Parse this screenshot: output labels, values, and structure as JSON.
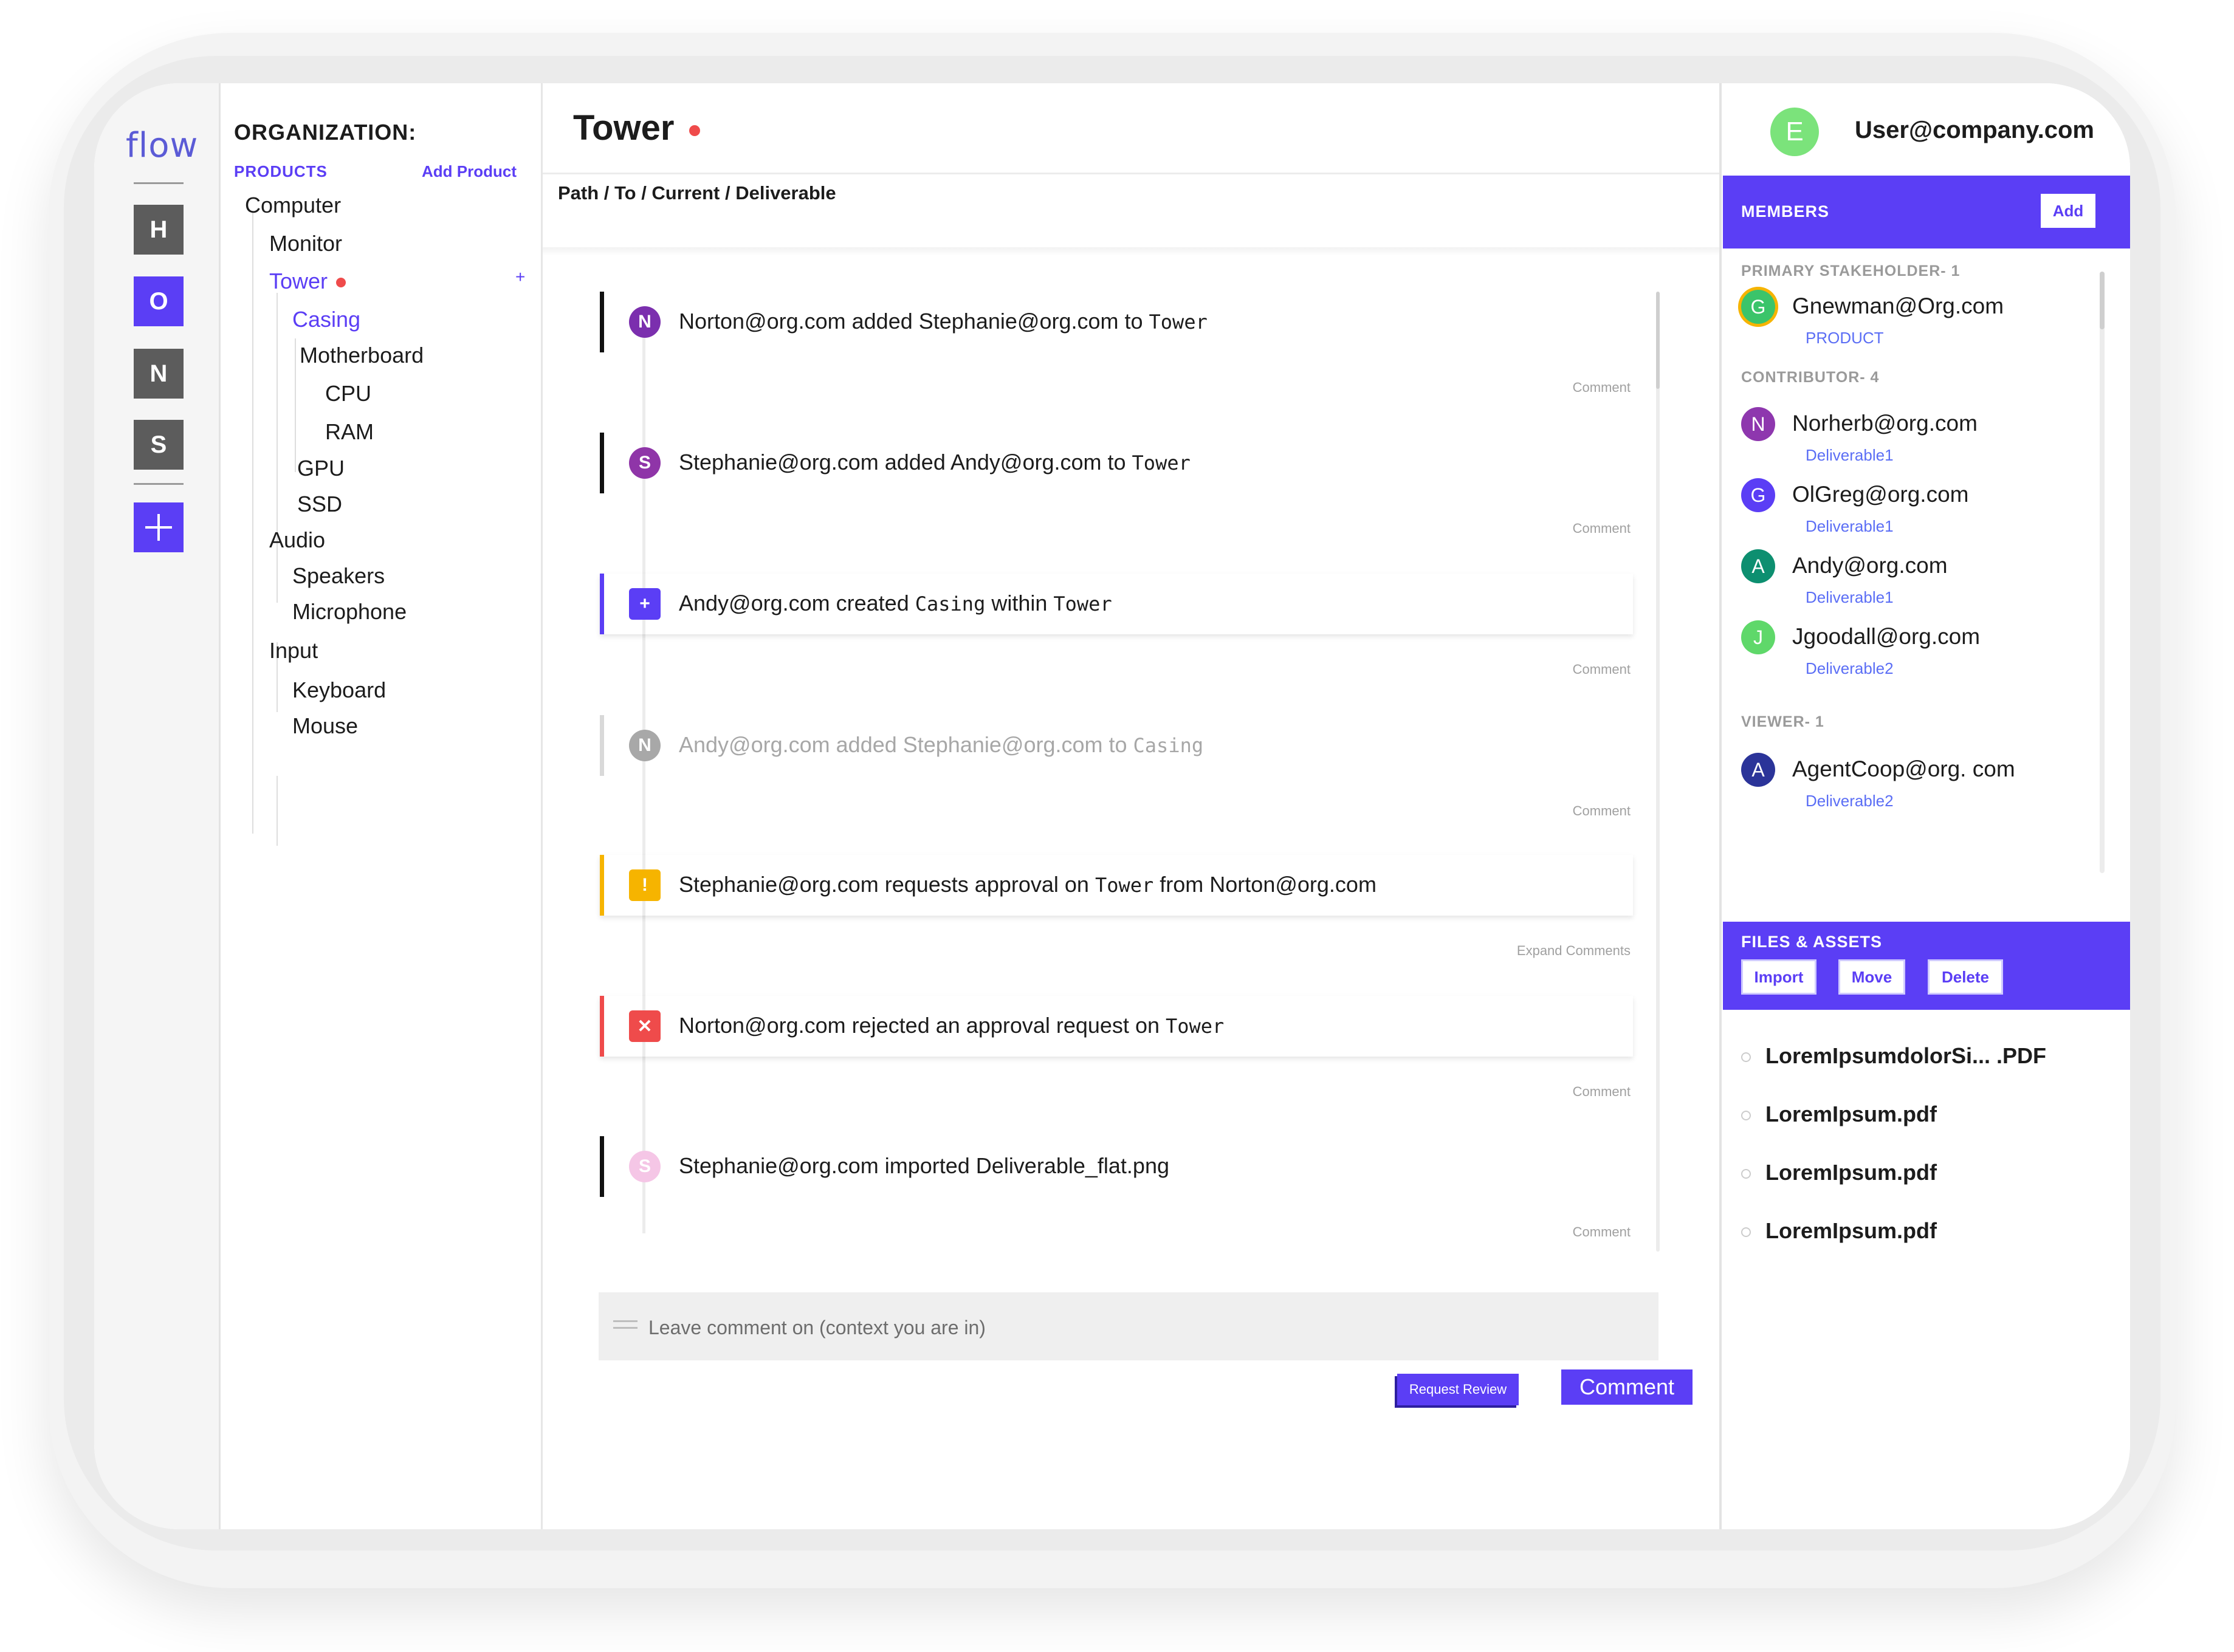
{
  "app": {
    "logo": "flow"
  },
  "rail": {
    "items": [
      {
        "label": "H",
        "color": "#5c5c5c"
      },
      {
        "label": "O",
        "color": "#5b3ef5"
      },
      {
        "label": "N",
        "color": "#5c5c5c"
      },
      {
        "label": "S",
        "color": "#5c5c5c"
      }
    ],
    "add_icon": "plus-icon"
  },
  "tree": {
    "org_title": "ORGANIZATION:",
    "products_label": "PRODUCTS",
    "add_product": "Add Product",
    "nodes": [
      {
        "label": "Computer"
      },
      {
        "label": "Monitor"
      },
      {
        "label": "Tower",
        "active": true
      },
      {
        "label": "Casing",
        "active": true
      },
      {
        "label": "Motherboard"
      },
      {
        "label": "CPU"
      },
      {
        "label": "RAM"
      },
      {
        "label": "GPU"
      },
      {
        "label": "SSD"
      },
      {
        "label": "Audio"
      },
      {
        "label": "Speakers"
      },
      {
        "label": "Microphone"
      },
      {
        "label": "Input"
      },
      {
        "label": "Keyboard"
      },
      {
        "label": "Mouse"
      }
    ],
    "add_child": "+"
  },
  "main": {
    "title": "Tower",
    "breadcrumb": "Path / To / Current / Deliverable",
    "events": [
      {
        "avatar": "N",
        "avatar_color": "#7b2fae",
        "bar_color": "#111111",
        "muted": false,
        "card": false,
        "parts": [
          "Norton@org.com added Stephanie@org.com to ",
          "Tower",
          ""
        ],
        "link": "Comment"
      },
      {
        "avatar": "S",
        "avatar_color": "#8f35a8",
        "bar_color": "#111111",
        "muted": false,
        "card": false,
        "parts": [
          "Stephanie@org.com added Andy@org.com to ",
          "Tower",
          ""
        ],
        "link": "Comment"
      },
      {
        "avatar": "+",
        "avatar_color": "#5b3ef5",
        "bar_color": "#5b3ef5",
        "muted": false,
        "card": true,
        "square": true,
        "parts": [
          "Andy@org.com created ",
          "Casing",
          " within ",
          "Tower"
        ],
        "link": "Comment"
      },
      {
        "avatar": "N",
        "avatar_color": "#a8a8a8",
        "bar_color": "#d9d9d9",
        "muted": true,
        "card": false,
        "parts": [
          "Andy@org.com added Stephanie@org.com to ",
          "Casing",
          ""
        ],
        "link": "Comment"
      },
      {
        "avatar": "!",
        "avatar_color": "#f6b400",
        "bar_color": "#f6b400",
        "muted": false,
        "card": true,
        "square": true,
        "parts": [
          "Stephanie@org.com requests approval on ",
          "Tower",
          " from Norton@org.com"
        ],
        "link": "Expand Comments"
      },
      {
        "avatar": "✕",
        "avatar_color": "#ef4b4b",
        "bar_color": "#ef4b4b",
        "muted": false,
        "card": true,
        "square": true,
        "parts": [
          "Norton@org.com rejected an approval request on ",
          "Tower",
          ""
        ],
        "link": "Comment"
      },
      {
        "avatar": "S",
        "avatar_color": "#f5c6e6",
        "bar_color": "#111111",
        "muted": false,
        "card": false,
        "parts": [
          "Stephanie@org.com imported Deliverable_flat.png",
          "",
          ""
        ],
        "link": "Comment"
      }
    ],
    "comment": {
      "placeholder": "Leave comment on (context you are in)",
      "request_review": "Request Review",
      "submit": "Comment"
    }
  },
  "right": {
    "user": {
      "initial": "E",
      "email": "User@company.com",
      "color": "#7be37b"
    },
    "members": {
      "title": "MEMBERS",
      "add": "Add",
      "primary_label": "PRIMARY STAKEHOLDER- 1",
      "primary": {
        "initial": "G",
        "name": "Gnewman@Org.com",
        "role": "PRODUCT",
        "color": "#3bc46a",
        "ring": "#f6b400"
      },
      "contributor_label": "CONTRIBUTOR- 4",
      "contributors": [
        {
          "initial": "N",
          "name": "Norherb@org.com",
          "role": "Deliverable1",
          "color": "#8e37ae"
        },
        {
          "initial": "G",
          "name": "OlGreg@org.com",
          "role": "Deliverable1",
          "color": "#5b3ef5"
        },
        {
          "initial": "A",
          "name": "Andy@org.com",
          "role": "Deliverable1",
          "color": "#0d8f70"
        },
        {
          "initial": "J",
          "name": "Jgoodall@org.com",
          "role": "Deliverable2",
          "color": "#5fd86a"
        }
      ],
      "viewer_label": "VIEWER- 1",
      "viewers": [
        {
          "initial": "A",
          "name": "AgentCoop@org. com",
          "role": "Deliverable2",
          "color": "#2b3499"
        }
      ]
    },
    "files": {
      "title": "FILES & ASSETS",
      "import": "Import",
      "move": "Move",
      "delete": "Delete",
      "items": [
        "LoremIpsumdolorSi... .PDF",
        "LoremIpsum.pdf",
        "LoremIpsum.pdf",
        "LoremIpsum.pdf"
      ]
    }
  }
}
